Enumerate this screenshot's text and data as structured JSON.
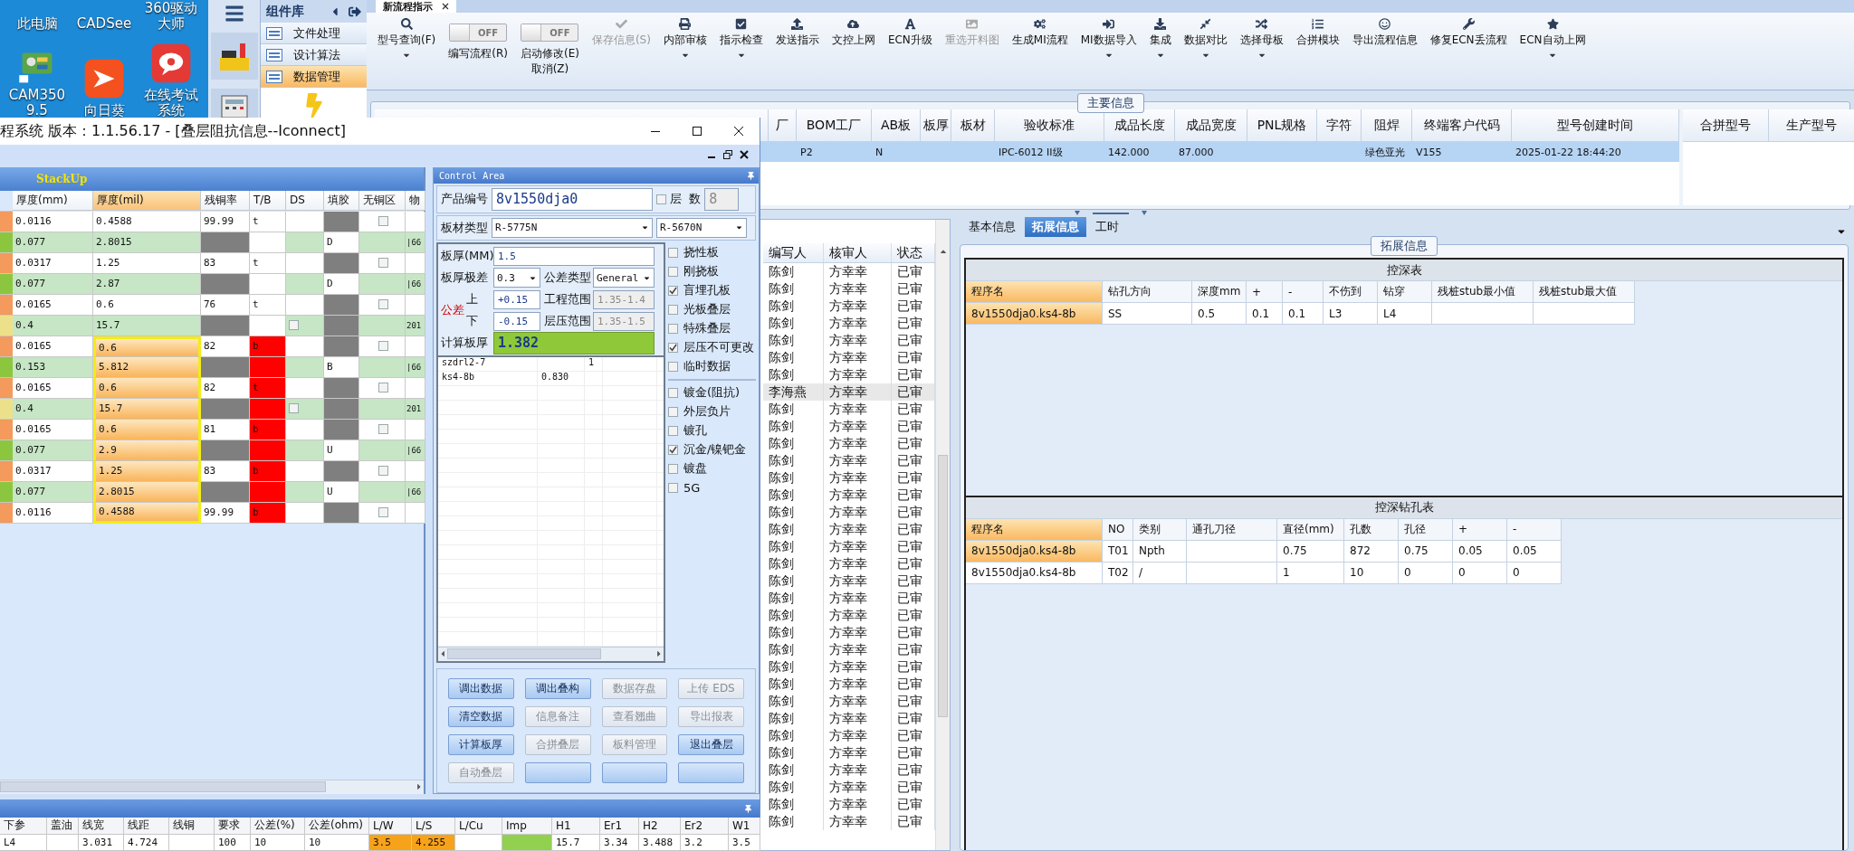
{
  "desktop": {
    "icons": [
      {
        "label": "此电脑",
        "kind": "label"
      },
      {
        "label": "CADSee",
        "kind": "label"
      },
      {
        "label": "360驱动大师",
        "kind": "label"
      },
      {
        "label": "CAM350 9.5",
        "kind": "cam"
      },
      {
        "label": "向日葵",
        "kind": "sun"
      },
      {
        "label": "在线考试系统",
        "kind": "exam"
      }
    ]
  },
  "library": {
    "title": "组件库",
    "items": [
      {
        "label": "文件处理",
        "selected": false
      },
      {
        "label": "设计算法",
        "selected": false
      },
      {
        "label": "数据管理",
        "selected": true
      }
    ]
  },
  "main": {
    "tab": {
      "label": "新流程指示"
    },
    "toolbar": [
      {
        "kind": "button",
        "label": "型号查询(F)",
        "dropdown": true,
        "disabled": false
      },
      {
        "kind": "toggle",
        "label": "编写流程(R)",
        "state_label": "OFF",
        "on": false
      },
      {
        "kind": "toggle",
        "label": "启动修改(E)\n取消(Z)",
        "state_label": "OFF",
        "on": false
      },
      {
        "kind": "button",
        "label": "保存信息(S)",
        "dropdown": false,
        "disabled": true
      },
      {
        "kind": "button",
        "label": "内部审核",
        "dropdown": true,
        "disabled": false
      },
      {
        "kind": "button",
        "label": "指示检查",
        "dropdown": true,
        "disabled": false
      },
      {
        "kind": "button",
        "label": "发送指示",
        "dropdown": false,
        "disabled": false
      },
      {
        "kind": "button",
        "label": "文控上网",
        "dropdown": false,
        "disabled": false
      },
      {
        "kind": "button",
        "label": "ECN升级",
        "dropdown": false,
        "disabled": false
      },
      {
        "kind": "button",
        "label": "重选开料图",
        "dropdown": false,
        "disabled": true
      },
      {
        "kind": "button",
        "label": "生成MI流程",
        "dropdown": false,
        "disabled": false
      },
      {
        "kind": "button",
        "label": "MI数据导入",
        "dropdown": true,
        "disabled": false
      },
      {
        "kind": "button",
        "label": "集成",
        "dropdown": true,
        "disabled": false
      },
      {
        "kind": "button",
        "label": "数据对比",
        "dropdown": true,
        "disabled": false
      },
      {
        "kind": "button",
        "label": "选择母板",
        "dropdown": true,
        "disabled": false
      },
      {
        "kind": "button",
        "label": "合拼模块",
        "dropdown": false,
        "disabled": false
      },
      {
        "kind": "button",
        "label": "导出流程信息",
        "dropdown": false,
        "disabled": false
      },
      {
        "kind": "button",
        "label": "修复ECN丢流程",
        "dropdown": false,
        "disabled": false
      },
      {
        "kind": "button",
        "label": "ECN自动上网",
        "dropdown": true,
        "disabled": false
      }
    ],
    "info": {
      "legend": "主要信息",
      "columns": [
        "厂",
        "BOM工厂",
        "AB板",
        "板厚",
        "板材",
        "验收标准",
        "成品长度",
        "成品宽度",
        "PNL规格",
        "字符",
        "阻焊",
        "终端客户代码",
        "型号创建时间"
      ],
      "rows": [
        {
          "selected": true,
          "cells": [
            null,
            "P2",
            "N",
            null,
            null,
            "IPC-6012 II级",
            "142.000",
            "87.000",
            null,
            null,
            "绿色亚光",
            "V155",
            "2025-01-22 18:44:20"
          ]
        }
      ],
      "side_columns": [
        "合拼型号",
        "生产型号"
      ]
    },
    "list": {
      "columns": [
        "编写人",
        "核审人",
        "状态"
      ],
      "rows": [
        {
          "cells": [
            "陈剑",
            "方幸幸",
            "已审"
          ],
          "selected": false
        },
        {
          "cells": [
            "陈剑",
            "方幸幸",
            "已审"
          ],
          "selected": false
        },
        {
          "cells": [
            "陈剑",
            "方幸幸",
            "已审"
          ],
          "selected": false
        },
        {
          "cells": [
            "陈剑",
            "方幸幸",
            "已审"
          ],
          "selected": false
        },
        {
          "cells": [
            "陈剑",
            "方幸幸",
            "已审"
          ],
          "selected": false
        },
        {
          "cells": [
            "陈剑",
            "方幸幸",
            "已审"
          ],
          "selected": false
        },
        {
          "cells": [
            "陈剑",
            "方幸幸",
            "已审"
          ],
          "selected": false
        },
        {
          "cells": [
            "李海燕",
            "方幸幸",
            "已审"
          ],
          "selected": true
        },
        {
          "cells": [
            "陈剑",
            "方幸幸",
            "已审"
          ],
          "selected": false
        },
        {
          "cells": [
            "陈剑",
            "方幸幸",
            "已审"
          ],
          "selected": false
        },
        {
          "cells": [
            "陈剑",
            "方幸幸",
            "已审"
          ],
          "selected": false
        },
        {
          "cells": [
            "陈剑",
            "方幸幸",
            "已审"
          ],
          "selected": false
        },
        {
          "cells": [
            "陈剑",
            "方幸幸",
            "已审"
          ],
          "selected": false
        },
        {
          "cells": [
            "陈剑",
            "方幸幸",
            "已审"
          ],
          "selected": false
        },
        {
          "cells": [
            "陈剑",
            "方幸幸",
            "已审"
          ],
          "selected": false
        },
        {
          "cells": [
            "陈剑",
            "方幸幸",
            "已审"
          ],
          "selected": false
        },
        {
          "cells": [
            "陈剑",
            "方幸幸",
            "已审"
          ],
          "selected": false
        },
        {
          "cells": [
            "陈剑",
            "方幸幸",
            "已审"
          ],
          "selected": false
        },
        {
          "cells": [
            "陈剑",
            "方幸幸",
            "已审"
          ],
          "selected": false
        },
        {
          "cells": [
            "陈剑",
            "方幸幸",
            "已审"
          ],
          "selected": false
        },
        {
          "cells": [
            "陈剑",
            "方幸幸",
            "已审"
          ],
          "selected": false
        },
        {
          "cells": [
            "陈剑",
            "方幸幸",
            "已审"
          ],
          "selected": false
        },
        {
          "cells": [
            "陈剑",
            "方幸幸",
            "已审"
          ],
          "selected": false
        },
        {
          "cells": [
            "陈剑",
            "方幸幸",
            "已审"
          ],
          "selected": false
        },
        {
          "cells": [
            "陈剑",
            "方幸幸",
            "已审"
          ],
          "selected": false
        },
        {
          "cells": [
            "陈剑",
            "方幸幸",
            "已审"
          ],
          "selected": false
        },
        {
          "cells": [
            "陈剑",
            "方幸幸",
            "已审"
          ],
          "selected": false
        },
        {
          "cells": [
            "陈剑",
            "方幸幸",
            "已审"
          ],
          "selected": false
        },
        {
          "cells": [
            "陈剑",
            "方幸幸",
            "已审"
          ],
          "selected": false
        },
        {
          "cells": [
            "陈剑",
            "方幸幸",
            "已审"
          ],
          "selected": false
        },
        {
          "cells": [
            "陈剑",
            "方幸幸",
            "已审"
          ],
          "selected": false
        },
        {
          "cells": [
            "陈剑",
            "方幸幸",
            "已审"
          ],
          "selected": false
        },
        {
          "cells": [
            "陈剑",
            "方幸幸",
            "已审"
          ],
          "selected": false
        }
      ]
    },
    "detail": {
      "tabs": [
        {
          "label": "基本信息",
          "selected": false
        },
        {
          "label": "拓展信息",
          "selected": true
        },
        {
          "label": "工时",
          "selected": false
        }
      ],
      "legend": "拓展信息",
      "tables": [
        {
          "title": "控深表",
          "columns": [
            {
              "label": "程序名",
              "sorted": true
            },
            {
              "label": "钻孔方向",
              "sorted": false
            },
            {
              "label": "深度mm",
              "sorted": false
            },
            {
              "label": "+",
              "sorted": false
            },
            {
              "label": "-",
              "sorted": false
            },
            {
              "label": "不伤到",
              "sorted": false
            },
            {
              "label": "钻穿",
              "sorted": false
            },
            {
              "label": "残桩stub最小值",
              "sorted": false
            },
            {
              "label": "残桩stub最大值",
              "sorted": false
            }
          ],
          "rows": [
            {
              "selected": true,
              "cells": [
                "8v1550dja0.ks4-8b",
                "SS",
                "0.5",
                "0.1",
                "0.1",
                "L3",
                "L4",
                null,
                null
              ]
            }
          ]
        },
        {
          "title": "控深钻孔表",
          "columns": [
            {
              "label": "程序名",
              "sorted": true
            },
            {
              "label": "NO",
              "sorted": false
            },
            {
              "label": "类别",
              "sorted": false
            },
            {
              "label": "通孔刀径",
              "sorted": false
            },
            {
              "label": "直径(mm)",
              "sorted": false
            },
            {
              "label": "孔数",
              "sorted": false
            },
            {
              "label": "孔径",
              "sorted": false
            },
            {
              "label": "+",
              "sorted": false
            },
            {
              "label": "-",
              "sorted": false
            }
          ],
          "rows": [
            {
              "selected": true,
              "cells": [
                "8v1550dja0.ks4-8b",
                "T01",
                "Npth",
                null,
                "0.75",
                "872",
                "0.75",
                "0.05",
                "0.05"
              ]
            },
            {
              "selected": false,
              "cells": [
                "8v1550dja0.ks4-8b",
                "T02",
                "/",
                null,
                "1",
                "10",
                "0",
                "0",
                "0"
              ]
            }
          ]
        }
      ]
    }
  },
  "dialog": {
    "title": "程系统  版本：1.1.56.17 - [叠层阻抗信息--Iconnect]",
    "stackup": {
      "title": "StackUp",
      "columns": [
        {
          "label": "厚度(mm)",
          "sorted": false
        },
        {
          "label": "厚度(mil)",
          "sorted": true
        },
        {
          "label": "残铜率",
          "sorted": false
        },
        {
          "label": "T/B",
          "sorted": false
        },
        {
          "label": "DS",
          "sorted": false
        },
        {
          "label": "填胶",
          "sorted": false
        },
        {
          "label": "无铜区",
          "sorted": false
        },
        {
          "label": "物",
          "sorted": false
        }
      ],
      "rows": [
        {
          "kind": "copper",
          "mm": "0.0116",
          "mil": "0.4588",
          "mil_selected": false,
          "residual": "99.99",
          "tb": "t",
          "tb_flagged": false,
          "no_copper": {
            "checked": false
          }
        },
        {
          "kind": "prepreg",
          "mm": "0.077",
          "mil": "2.8015",
          "mil_selected": false,
          "tb_flagged": false,
          "fill": "D",
          "material": "|66"
        },
        {
          "kind": "copper",
          "mm": "0.0317",
          "mil": "1.25",
          "mil_selected": false,
          "residual": "83",
          "tb": "t",
          "tb_flagged": false,
          "no_copper": {
            "checked": false
          }
        },
        {
          "kind": "prepreg",
          "mm": "0.077",
          "mil": "2.87",
          "mil_selected": false,
          "tb_flagged": false,
          "fill": "D",
          "material": "|66"
        },
        {
          "kind": "copper",
          "mm": "0.0165",
          "mil": "0.6",
          "mil_selected": false,
          "residual": "76",
          "tb": "t",
          "tb_flagged": false,
          "no_copper": {
            "checked": false
          }
        },
        {
          "kind": "core",
          "mm": "0.4",
          "mil": "15.7",
          "mil_selected": false,
          "tb_flagged": false,
          "ds": {
            "checked": false
          },
          "material": "201"
        },
        {
          "kind": "copper",
          "mm": "0.0165",
          "mil": "0.6",
          "mil_selected": true,
          "residual": "82",
          "tb": "b",
          "tb_flagged": true,
          "no_copper": {
            "checked": false
          }
        },
        {
          "kind": "prepreg",
          "mm": "0.153",
          "mil": "5.812",
          "mil_selected": true,
          "tb_flagged": true,
          "fill": "B",
          "material": "|66"
        },
        {
          "kind": "copper",
          "mm": "0.0165",
          "mil": "0.6",
          "mil_selected": true,
          "residual": "82",
          "tb": "t",
          "tb_flagged": true,
          "no_copper": {
            "checked": false
          }
        },
        {
          "kind": "core",
          "mm": "0.4",
          "mil": "15.7",
          "mil_selected": true,
          "tb_flagged": true,
          "ds": {
            "checked": false
          },
          "material": "201"
        },
        {
          "kind": "copper",
          "mm": "0.0165",
          "mil": "0.6",
          "mil_selected": true,
          "residual": "81",
          "tb": "b",
          "tb_flagged": true,
          "no_copper": {
            "checked": false
          }
        },
        {
          "kind": "prepreg",
          "mm": "0.077",
          "mil": "2.9",
          "mil_selected": true,
          "tb_flagged": true,
          "fill": "U",
          "material": "|66"
        },
        {
          "kind": "copper",
          "mm": "0.0317",
          "mil": "1.25",
          "mil_selected": true,
          "residual": "83",
          "tb": "b",
          "tb_flagged": true,
          "no_copper": {
            "checked": false
          }
        },
        {
          "kind": "prepreg",
          "mm": "0.077",
          "mil": "2.8015",
          "mil_selected": true,
          "tb_flagged": true,
          "fill": "U",
          "material": "|66"
        },
        {
          "kind": "copper",
          "mm": "0.0116",
          "mil": "0.4588",
          "mil_selected": true,
          "residual": "99.99",
          "tb": "b",
          "tb_flagged": true,
          "no_copper": {
            "checked": false
          }
        }
      ]
    },
    "control": {
      "title": "Control Area",
      "product": {
        "label": "产品编号",
        "value": "8v1550dja0",
        "layers_checked": false,
        "layers_label": "层  数",
        "layers_value": "8"
      },
      "material": {
        "label": "板材类型",
        "value": "R-5775N",
        "value2": "R-5670N"
      },
      "thickness": {
        "label": "板厚(MM)",
        "value": "1.5"
      },
      "range": {
        "label": "板厚极差",
        "value": "0.3",
        "type_label": "公差类型",
        "type_value": "General"
      },
      "tolerance": {
        "label": "公差",
        "upper_label": "上",
        "upper": "+0.15",
        "lower_label": "下",
        "lower": "-0.15",
        "eng_label": "工程范围",
        "eng_value": "1.35-1.4",
        "press_label": "层压范围",
        "press_value": "1.35-1.5"
      },
      "calc": {
        "label": "计算板厚",
        "value": "1.382"
      },
      "options": [
        {
          "label": "挠性板",
          "checked": false
        },
        {
          "label": "刚挠板",
          "checked": false
        },
        {
          "label": "盲埋孔板",
          "checked": true
        },
        {
          "label": "光板叠层",
          "checked": false
        },
        {
          "label": "特殊叠层",
          "checked": false
        },
        {
          "label": "层压不可更改",
          "checked": true
        },
        {
          "label": "临时数据",
          "checked": false
        }
      ],
      "options2": [
        {
          "label": "镀金(阻抗)",
          "checked": false
        },
        {
          "label": "外层负片",
          "checked": false
        },
        {
          "label": "镀孔",
          "checked": false
        },
        {
          "label": "沉金/镍钯金",
          "checked": true
        },
        {
          "label": "镀盘",
          "checked": false
        },
        {
          "label": "5G",
          "checked": false
        }
      ],
      "grid": [
        {
          "column_1": "szdrl2-7",
          "column_3": "1"
        },
        {
          "column_1": "ks4-8b",
          "column_2": "0.830"
        }
      ],
      "buttons": [
        {
          "label": "调出数据",
          "disabled": false
        },
        {
          "label": "调出叠构",
          "disabled": false
        },
        {
          "label": "数据存盘",
          "disabled": true
        },
        {
          "label": "上传 EDS",
          "disabled": true
        },
        {
          "label": "清空数据",
          "disabled": false
        },
        {
          "label": "信息备注",
          "disabled": true
        },
        {
          "label": "查看翘曲",
          "disabled": true
        },
        {
          "label": "导出报表",
          "disabled": true
        },
        {
          "label": "计算板厚",
          "disabled": false
        },
        {
          "label": "合拼叠层",
          "disabled": true
        },
        {
          "label": "板料管理",
          "disabled": true
        },
        {
          "label": "退出叠层",
          "disabled": false
        },
        {
          "label": "自动叠层",
          "disabled": true
        },
        {
          "disabled": false
        },
        {
          "disabled": false
        },
        {
          "disabled": false
        }
      ]
    },
    "impedance": {
      "columns": [
        "下参",
        "盖油",
        "线宽",
        "线距",
        "线铜",
        "要求",
        "公差(%)",
        "公差(ohm)",
        "L/W",
        "L/S",
        "L/Cu",
        "Imp",
        "H1",
        "Er1",
        "H2",
        "Er2",
        "W1"
      ],
      "rows": [
        {
          "cells": [
            {
              "text": "L4"
            },
            {},
            {
              "text": "3.031"
            },
            {
              "text": "4.724"
            },
            {},
            {
              "text": "100"
            },
            {
              "text": "10"
            },
            {
              "text": "10"
            },
            {
              "text": "3.5",
              "color": "#f7a21b"
            },
            {
              "text": "4.255",
              "color": "#f7a21b"
            },
            {},
            {
              "color": "#92d050"
            },
            {
              "text": "15.7"
            },
            {
              "text": "3.34"
            },
            {
              "text": "3.488"
            },
            {
              "text": "3.2"
            },
            {
              "text": "3.5"
            }
          ]
        }
      ]
    }
  }
}
